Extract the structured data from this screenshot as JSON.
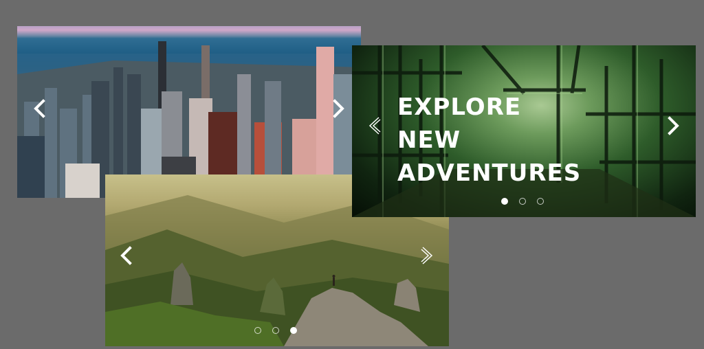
{
  "sliders": [
    {
      "id": "city",
      "dots": []
    },
    {
      "id": "adventures",
      "headline": [
        "EXPLORE",
        "NEW",
        "ADVENTURES"
      ],
      "dots": [
        true,
        false,
        false
      ]
    },
    {
      "id": "mountains",
      "dots": [
        false,
        false,
        true
      ]
    }
  ],
  "icons": {
    "prev_solid": "chevron-left-icon",
    "next_solid": "chevron-right-icon",
    "prev_outline": "chevron-left-outline-icon",
    "next_outline": "chevron-right-outline-icon"
  },
  "colors": {
    "page_background": "#6b6b6b",
    "arrow": "#ffffff",
    "dot_active": "#ffffff"
  }
}
